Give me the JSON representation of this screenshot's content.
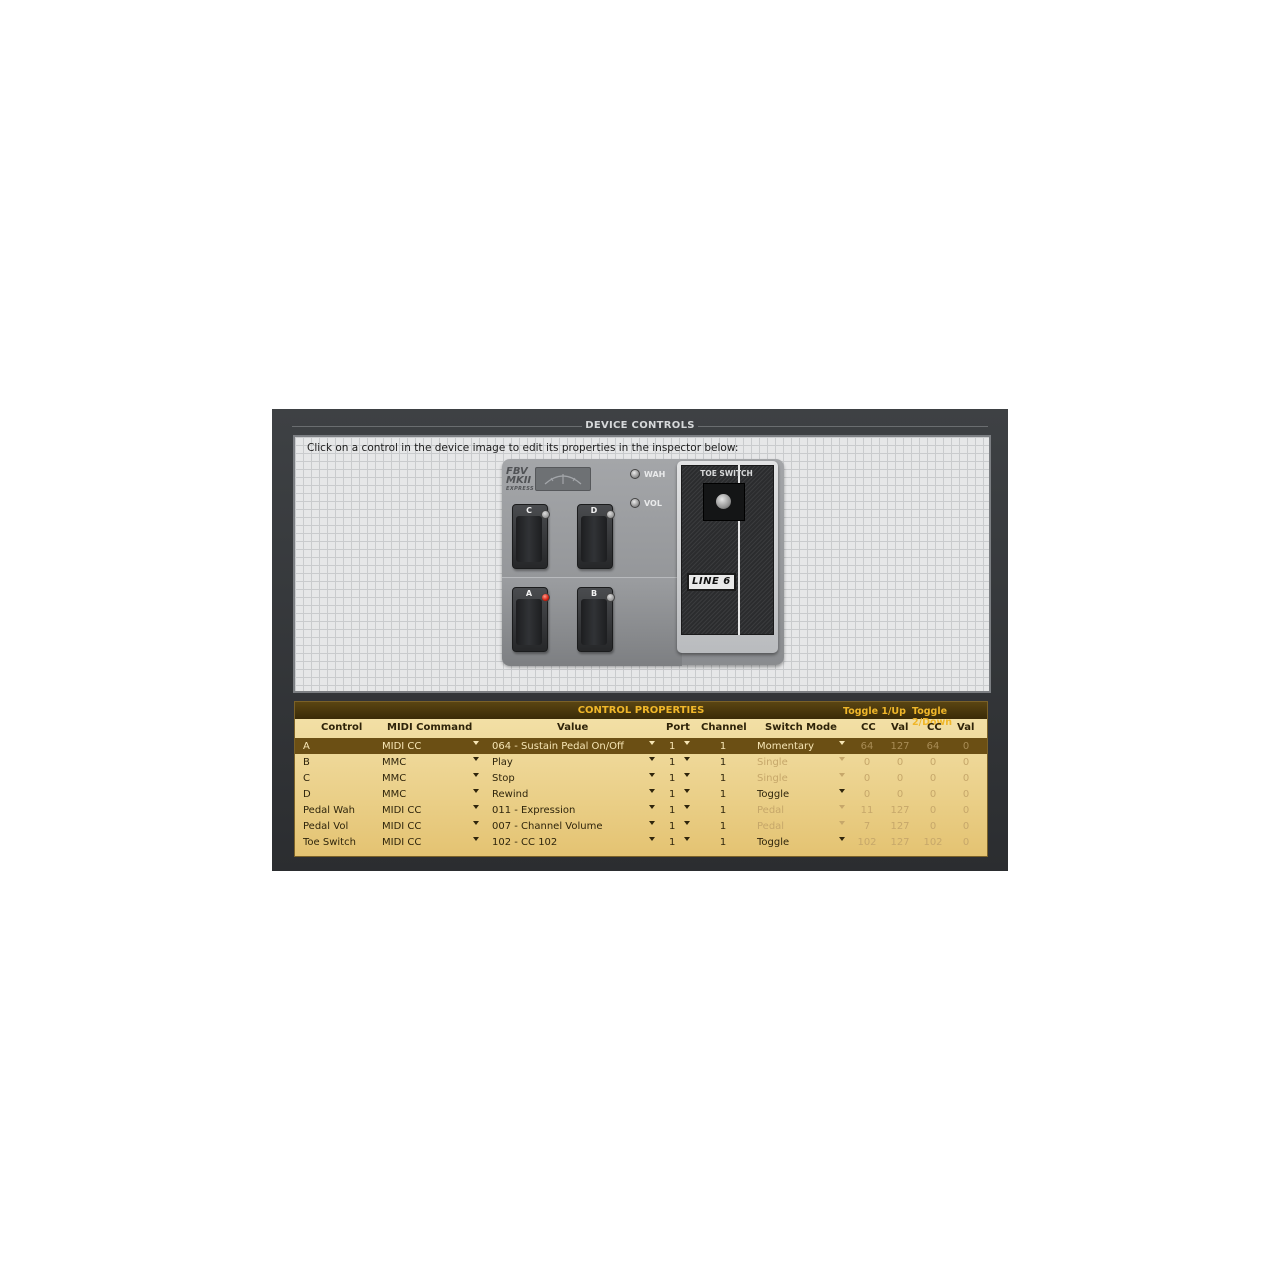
{
  "device_controls": {
    "title": "DEVICE CONTROLS",
    "instruction": "Click on a control in the device image to edit its properties in the inspector below:",
    "device": {
      "logo_line1": "FBV",
      "logo_line2": "MKII",
      "logo_line3": "EXPRESS",
      "wah_label": "WAH",
      "vol_label": "VOL",
      "switches": {
        "c": "C",
        "d": "D",
        "a": "A",
        "b": "B"
      },
      "toe_switch_label": "TOE SWITCH",
      "brand": "LINE 6"
    }
  },
  "control_properties": {
    "title": "CONTROL PROPERTIES",
    "toggle1": "Toggle 1/Up",
    "toggle2": "Toggle 2/Down",
    "columns": {
      "control": "Control",
      "midi_command": "MIDI Command",
      "value": "Value",
      "port": "Port",
      "channel": "Channel",
      "switch_mode": "Switch Mode",
      "cc1": "CC",
      "val1": "Val",
      "cc2": "CC",
      "val2": "Val"
    },
    "rows": [
      {
        "control": "A",
        "midi": "MIDI CC",
        "value": "064 - Sustain Pedal On/Off",
        "port": "1",
        "channel": "1",
        "mode": "Momentary",
        "cc1": "64",
        "val1": "127",
        "cc2": "64",
        "val2": "0"
      },
      {
        "control": "B",
        "midi": "MMC",
        "value": "Play",
        "port": "1",
        "channel": "1",
        "mode": "Single",
        "cc1": "0",
        "val1": "0",
        "cc2": "0",
        "val2": "0"
      },
      {
        "control": "C",
        "midi": "MMC",
        "value": "Stop",
        "port": "1",
        "channel": "1",
        "mode": "Single",
        "cc1": "0",
        "val1": "0",
        "cc2": "0",
        "val2": "0"
      },
      {
        "control": "D",
        "midi": "MMC",
        "value": "Rewind",
        "port": "1",
        "channel": "1",
        "mode": "Toggle",
        "cc1": "0",
        "val1": "0",
        "cc2": "0",
        "val2": "0"
      },
      {
        "control": "Pedal Wah",
        "midi": "MIDI CC",
        "value": "011 - Expression",
        "port": "1",
        "channel": "1",
        "mode": "Pedal",
        "cc1": "11",
        "val1": "127",
        "cc2": "0",
        "val2": "0"
      },
      {
        "control": "Pedal Vol",
        "midi": "MIDI CC",
        "value": "007 - Channel Volume",
        "port": "1",
        "channel": "1",
        "mode": "Pedal",
        "cc1": "7",
        "val1": "127",
        "cc2": "0",
        "val2": "0"
      },
      {
        "control": "Toe Switch",
        "midi": "MIDI CC",
        "value": "102 - CC 102",
        "port": "1",
        "channel": "1",
        "mode": "Toggle",
        "cc1": "102",
        "val1": "127",
        "cc2": "102",
        "val2": "0"
      }
    ],
    "selected_row": 0,
    "dimmed_modes": [
      "Single",
      "Pedal"
    ]
  },
  "colors": {
    "panel_bg": "#34373a",
    "props_header_text": "#f0b72a",
    "selected_row_bg": "#6b4f14",
    "active_led": "#d21f10"
  }
}
